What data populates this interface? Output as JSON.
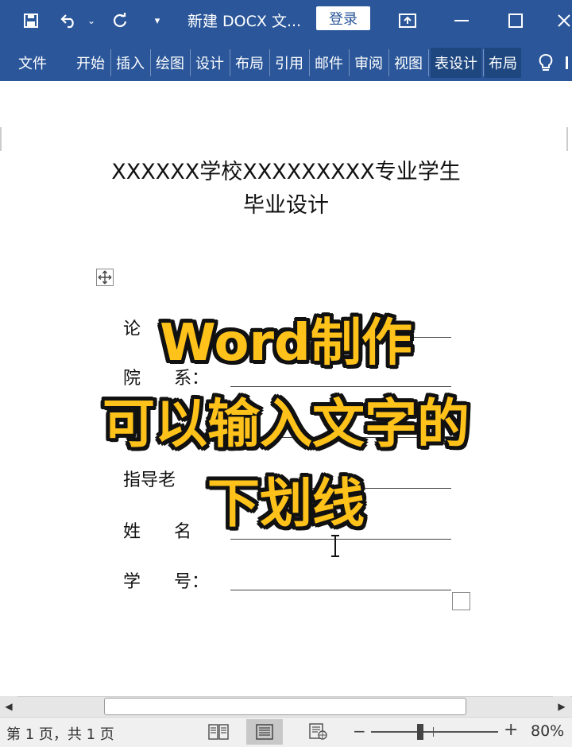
{
  "titlebar": {
    "doc_title": "新建 DOCX 文...",
    "login_label": "登录"
  },
  "ribbon": {
    "tabs": [
      {
        "label": "文件"
      },
      {
        "label": "开始"
      },
      {
        "label": "插入"
      },
      {
        "label": "绘图"
      },
      {
        "label": "设计"
      },
      {
        "label": "布局"
      },
      {
        "label": "引用"
      },
      {
        "label": "邮件"
      },
      {
        "label": "审阅"
      },
      {
        "label": "视图"
      },
      {
        "label": "表设计"
      },
      {
        "label": "布局"
      }
    ]
  },
  "document": {
    "title_line1": "XXXXXX学校XXXXXXXXX专业学生",
    "title_line2": "毕业设计",
    "fields": [
      {
        "label": "论"
      },
      {
        "label": "院      系："
      },
      {
        "label": "专"
      },
      {
        "label": "指导老"
      },
      {
        "label": "姓      名"
      },
      {
        "label": "学      号："
      }
    ]
  },
  "overlay": {
    "line1": "Word制作",
    "line2": "可以输入文字的",
    "line3": "下划线"
  },
  "statusbar": {
    "page_info": "第 1 页，共 1 页",
    "zoom_minus": "−",
    "zoom_plus": "+",
    "zoom_level": "80%"
  },
  "colors": {
    "ribbon_blue": "#2b579a",
    "overlay_yellow": "#ffc21a"
  }
}
